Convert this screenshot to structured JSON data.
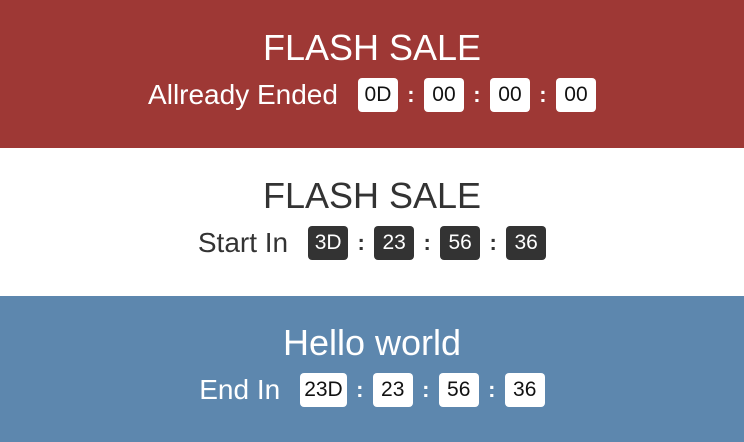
{
  "colors": {
    "red_bg": "#9e3835",
    "white_bg": "#ffffff",
    "blue_bg": "#5d87ae",
    "dark_text": "#333333",
    "dark_box": "#333333"
  },
  "banners": [
    {
      "title": "FLASH SALE",
      "label": "Allready Ended",
      "days": "0D",
      "hours": "00",
      "minutes": "00",
      "seconds": "00",
      "separator": ":"
    },
    {
      "title": "FLASH SALE",
      "label": "Start In",
      "days": "3D",
      "hours": "23",
      "minutes": "56",
      "seconds": "36",
      "separator": ":"
    },
    {
      "title": "Hello world",
      "label": "End In",
      "days": "23D",
      "hours": "23",
      "minutes": "56",
      "seconds": "36",
      "separator": ":"
    }
  ]
}
